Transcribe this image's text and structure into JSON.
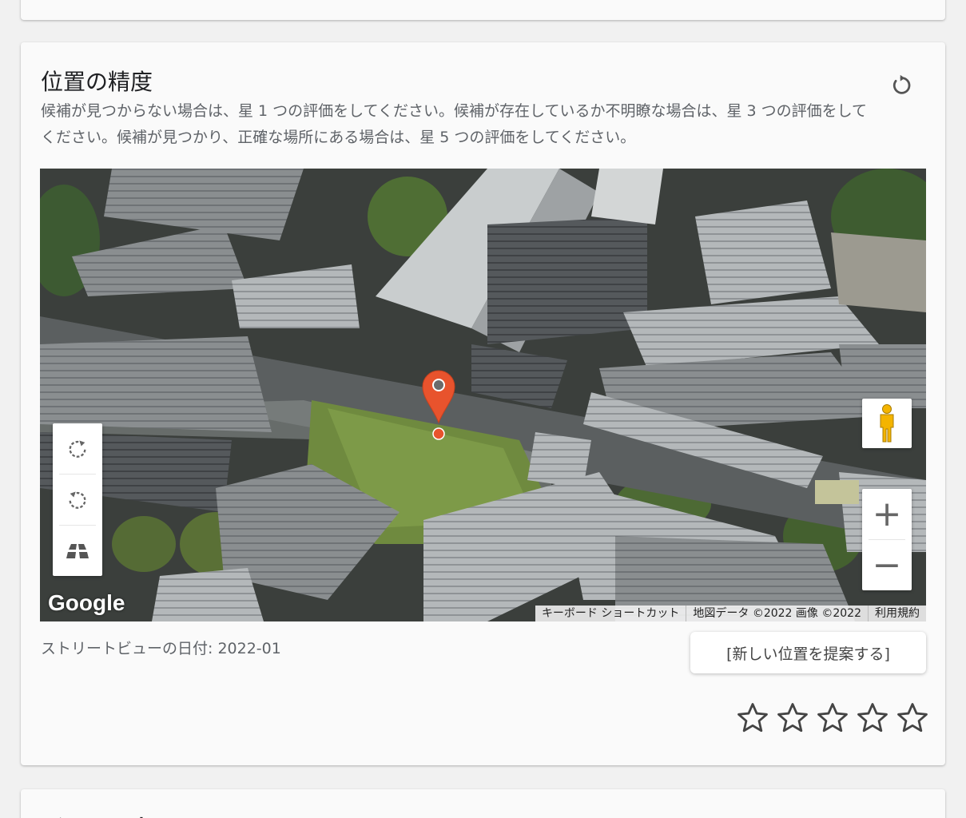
{
  "section": {
    "title": "位置の精度",
    "description": "候補が見つからない場合は、星 1 つの評価をしてください。候補が存在しているか不明瞭な場合は、星 3 つの評価をしてください。候補が見つかり、正確な場所にある場合は、星 5 つの評価をしてください。",
    "reset_icon": "refresh-icon"
  },
  "map": {
    "logo": "Google",
    "attribution": {
      "shortcuts": "キーボード ショートカット",
      "data": "地図データ ©2022 画像 ©2022",
      "terms": "利用規約"
    },
    "controls": {
      "rotate_cw_icon": "rotate-clockwise-icon",
      "rotate_ccw_icon": "rotate-counterclockwise-icon",
      "tilt_icon": "tilt-icon",
      "pegman_icon": "pegman-icon",
      "zoom_in": "+",
      "zoom_out": "−"
    },
    "marker_icon": "map-pin-icon"
  },
  "streetview_date": "ストリートビューの日付: 2022-01",
  "suggest_button": "[新しい位置を提案する]",
  "rating": {
    "max": 5,
    "value": 0,
    "color": "#444444"
  },
  "next_section": {
    "title": "どちらを表すか？"
  },
  "colors": {
    "accent": "#e8532d",
    "card": "#fafafa",
    "background": "#f1f1f1"
  }
}
